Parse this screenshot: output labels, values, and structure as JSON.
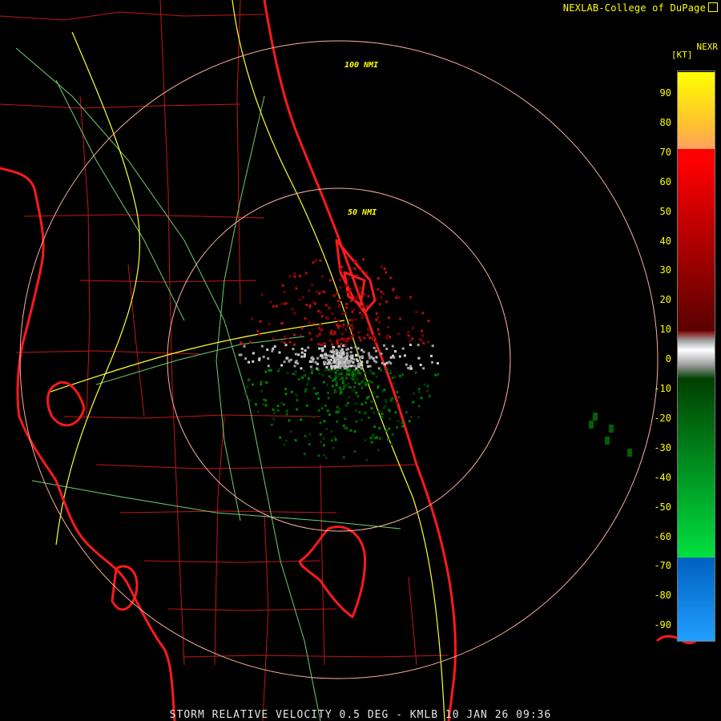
{
  "header": {
    "credit": "NEXLAB-College of DuPage",
    "credit_icon": "external-link-icon"
  },
  "caption": "STORM RELATIVE VELOCITY 0.5 DEG - KMLB 10 JAN 26 09:36",
  "legend": {
    "product": "NEXR",
    "unit": "[KT]",
    "ticks": [
      "90",
      "80",
      "70",
      "60",
      "50",
      "40",
      "30",
      "20",
      "10",
      "0",
      "-10",
      "-20",
      "-30",
      "-40",
      "-50",
      "-60",
      "-70",
      "-80",
      "-90"
    ],
    "colors": {
      "high": "#ffff00",
      "orange": "#ffa060",
      "red": "#ff0000",
      "darkred": "#5a0000",
      "gray": "#a0a0a0",
      "darkgreen": "#004000",
      "green": "#00e040",
      "blue": "#0060c0",
      "lightblue": "#20a0ff"
    }
  },
  "range_rings": [
    {
      "label": "100 NMI",
      "range_nmi": 100
    },
    {
      "label": "50 NMI",
      "range_nmi": 50
    }
  ],
  "map_colors": {
    "coast": "#ff1a1a",
    "county": "#c01818",
    "interstate": "#ffff30",
    "highway": "#70d070",
    "ring": "#ffb0a0"
  }
}
